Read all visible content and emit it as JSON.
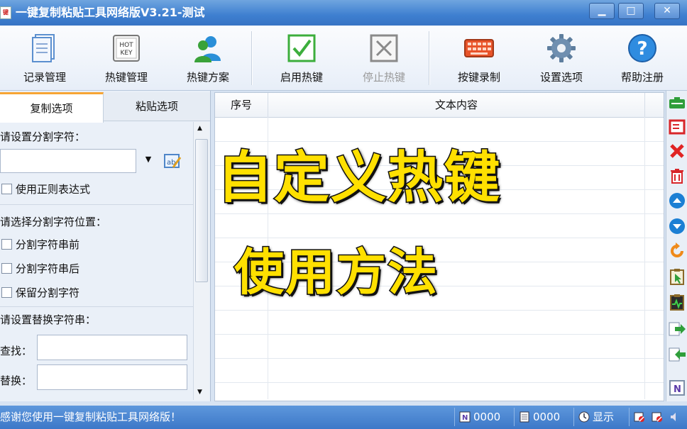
{
  "window": {
    "title": "一键复制粘贴工具网络版V3.21-测试",
    "icon_text": "键"
  },
  "toolbar": {
    "record_manage": "记录管理",
    "hotkey_manage": "热键管理",
    "hotkey_scheme": "热键方案",
    "enable_hotkey": "启用热键",
    "stop_hotkey": "停止热键",
    "key_record": "按键录制",
    "settings": "设置选项",
    "help_register": "帮助注册",
    "hotkey_icon_text": "HOT KEY"
  },
  "tabs": {
    "copy": "复制选项",
    "paste": "粘贴选项"
  },
  "copy_options": {
    "set_delimiter": "请设置分割字符：",
    "delimiter_value": "",
    "use_regex": "使用正则表达式",
    "choose_position": "请选择分割字符位置：",
    "before_string": "分割字符串前",
    "after_string": "分割字符串后",
    "keep_delimiter": "保留分割字符",
    "set_replace": "请设置替换字符串：",
    "find_label": "查找：",
    "replace_label": "替换：",
    "find_value": "",
    "replace_value": ""
  },
  "grid": {
    "col_index": "序号",
    "col_content": "文本内容"
  },
  "overlay": {
    "line1": "自定义热键",
    "line2": "使用方法"
  },
  "status": {
    "message": "感谢您使用一键复制粘贴工具网络版！",
    "count_n": "0000",
    "count_doc": "0000",
    "show": "显示"
  },
  "colors": {
    "accent_tab": "#f7a534",
    "title_bar": "#3e7fd0",
    "overlay_fill": "#ffe000",
    "enable_green": "#3cae3c"
  }
}
